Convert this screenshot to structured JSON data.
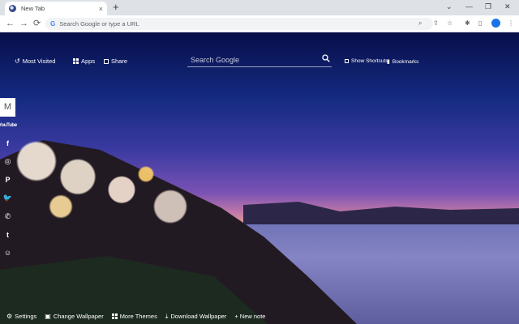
{
  "tab": {
    "title": "New Tab",
    "close": "×",
    "new_tab": "+"
  },
  "window": {
    "minimize": "—",
    "maximize": "❐",
    "close": "✕",
    "chevron": "⌄"
  },
  "nav": {
    "back": "←",
    "forward": "→",
    "reload": "⟳"
  },
  "omnibox": {
    "placeholder": "Search Google or type a URL",
    "g": "G"
  },
  "toolbar_icons": {
    "zoom": "⌕",
    "share": "⇪",
    "star": "☆",
    "extensions": "✱",
    "sidepanel": "▯",
    "menu": "⋮"
  },
  "top": {
    "most_visited": "Most Visited",
    "apps": "Apps",
    "share": "Share",
    "search_placeholder": "Search Google",
    "show_shortcuts": "Show Shortcuts",
    "bookmarks": "Bookmarks"
  },
  "sidebar": [
    {
      "name": "gmail",
      "glyph": "M"
    },
    {
      "name": "youtube",
      "glyph": "YouTube"
    },
    {
      "name": "facebook",
      "glyph": "f"
    },
    {
      "name": "instagram",
      "glyph": "◎"
    },
    {
      "name": "pinterest",
      "glyph": "P"
    },
    {
      "name": "twitter",
      "glyph": "🐦"
    },
    {
      "name": "whatsapp",
      "glyph": "✆"
    },
    {
      "name": "tumblr",
      "glyph": "t"
    },
    {
      "name": "reddit",
      "glyph": "☺"
    }
  ],
  "bottom": {
    "settings": "Settings",
    "change_wallpaper": "Change Wallpaper",
    "more_themes": "More Themes",
    "download_wallpaper": "Download Wallpaper",
    "new_note": "+ New note"
  }
}
